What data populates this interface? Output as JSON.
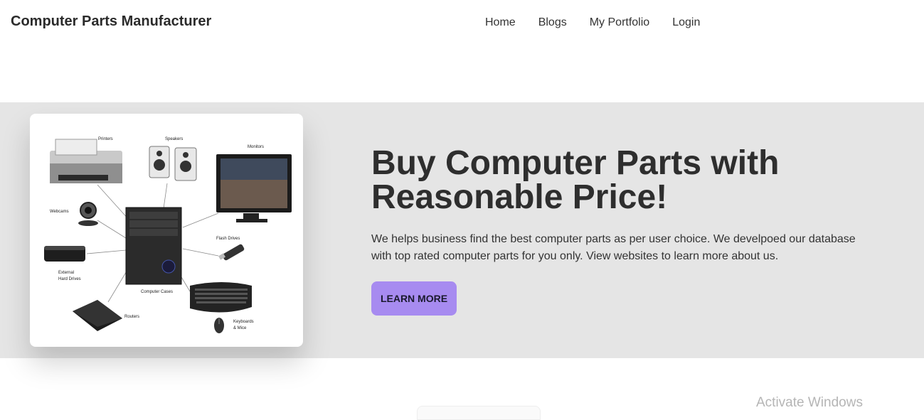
{
  "header": {
    "brand": "Computer Parts Manufacturer",
    "nav": [
      "Home",
      "Blogs",
      "My Portfolio",
      "Login"
    ]
  },
  "hero": {
    "title": "Buy Computer Parts with Reasonable Price!",
    "description": "We helps business find the best computer parts as per user choice. We develpoed our database with top rated computer parts for you only. View websites to learn more about us.",
    "button_label": "LEARN MORE",
    "image_labels": {
      "printers": "Printers",
      "speakers": "Speakers",
      "monitors": "Monitors",
      "webcams": "Webcams",
      "flash_drives": "Flash Drives",
      "external_hd_line1": "External",
      "external_hd_line2": "Hard Drives",
      "computer_cases": "Computer Cases",
      "routers": "Routers",
      "keyboards_line1": "Keyboards",
      "keyboards_line2": "& Mice"
    }
  },
  "colors": {
    "hero_background": "#e5e5e5",
    "button": "#a78bf0"
  },
  "watermark": "Activate Windows"
}
